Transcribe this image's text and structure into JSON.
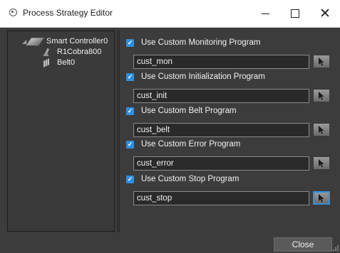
{
  "window": {
    "title": "Process Strategy Editor",
    "minimize_glyph": "—",
    "maximize_glyph": "☐",
    "close_glyph": "✕"
  },
  "tree": {
    "root": {
      "label": "Smart Controller0",
      "icon": "controller-icon",
      "expander": "◢"
    },
    "children": [
      {
        "label": "R1Cobra800",
        "icon": "robot-icon"
      },
      {
        "label": "Belt0",
        "icon": "belt-icon"
      }
    ]
  },
  "options": [
    {
      "label": "Use Custom Monitoring Program",
      "checked": true,
      "value": "cust_mon"
    },
    {
      "label": "Use Custom Initialization Program",
      "checked": true,
      "value": "cust_init"
    },
    {
      "label": "Use Custom Belt Program",
      "checked": true,
      "value": "cust_belt"
    },
    {
      "label": "Use Custom Error Program",
      "checked": true,
      "value": "cust_error"
    },
    {
      "label": "Use Custom Stop Program",
      "checked": true,
      "value": "cust_stop"
    }
  ],
  "checkmark": "✓",
  "footer": {
    "close_label": "Close"
  },
  "colors": {
    "accent": "#2d8fe0",
    "background": "#3c3c3c",
    "panel": "#3a3a3a"
  }
}
